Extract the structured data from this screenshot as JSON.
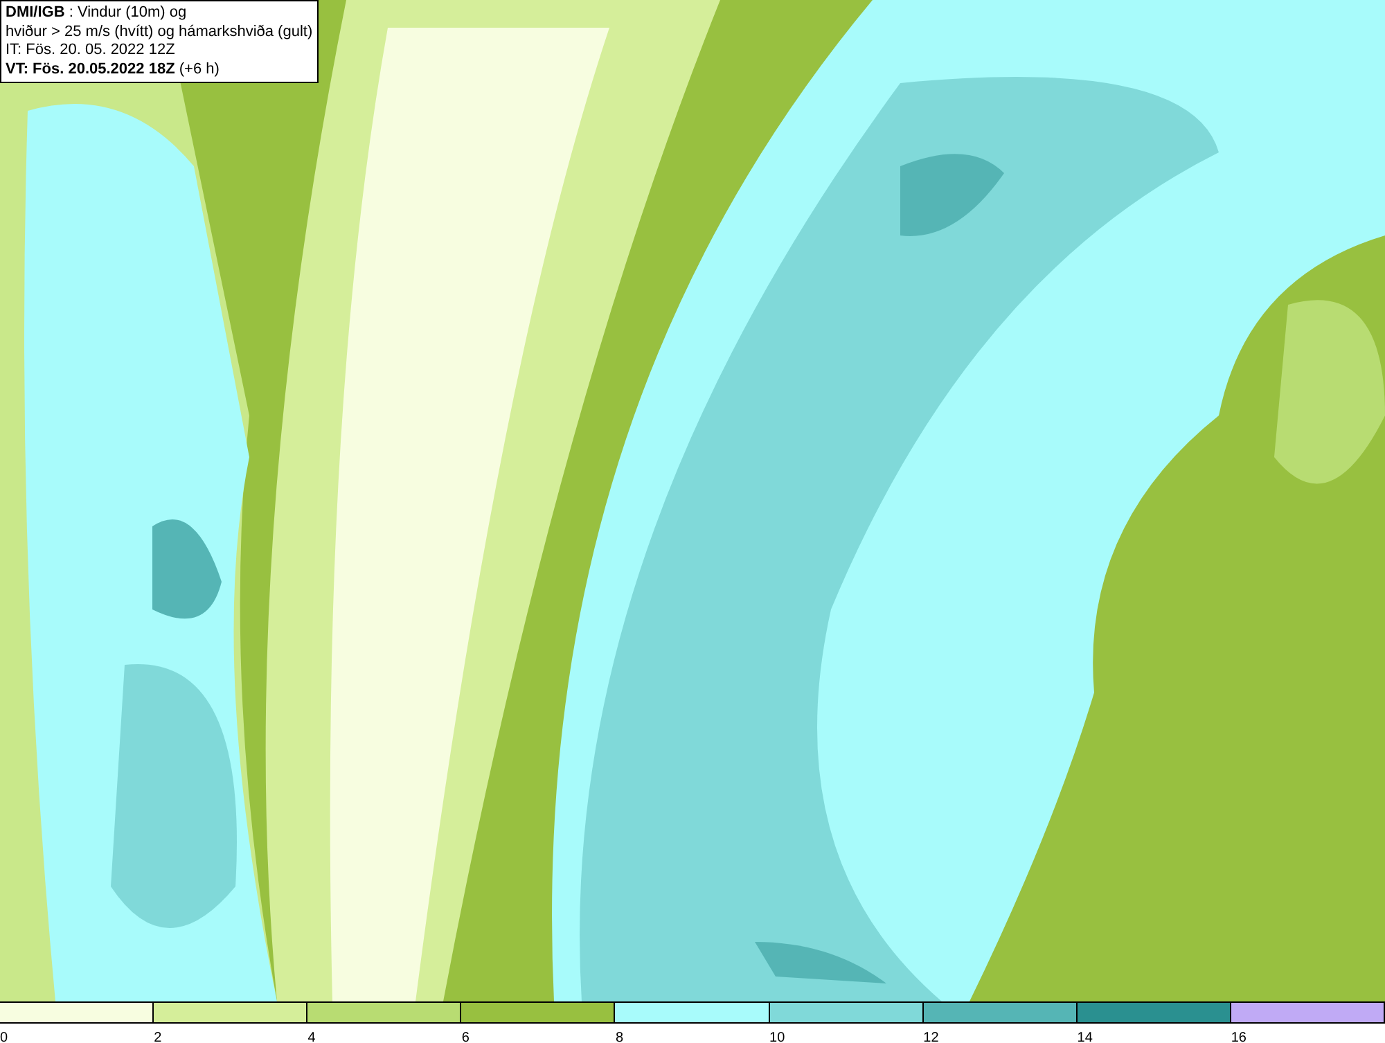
{
  "header": {
    "lines": [
      "**DMI/IGB** : Vindur (10m) og",
      "hviður > 25 m/s (hvítt) og hámarkshviða (gult)",
      "IT: Fös. 20. 05. 2022 12Z",
      "**VT: Fös. 20.05.2022 18Z** (+6 h)"
    ]
  },
  "legend": {
    "segments": [
      {
        "color": "#f7fde0",
        "label": "0"
      },
      {
        "color": "#d5ee9a",
        "label": "2"
      },
      {
        "color": "#b8dc72",
        "label": "4"
      },
      {
        "color": "#98c040",
        "label": "6"
      },
      {
        "color": "#a8fbfb",
        "label": "8"
      },
      {
        "color": "#80d9d9",
        "label": "10"
      },
      {
        "color": "#55b5b5",
        "label": "12"
      },
      {
        "color": "#2a9090",
        "label": "14"
      },
      {
        "color": "#c0aaf5",
        "label": "16"
      }
    ]
  }
}
